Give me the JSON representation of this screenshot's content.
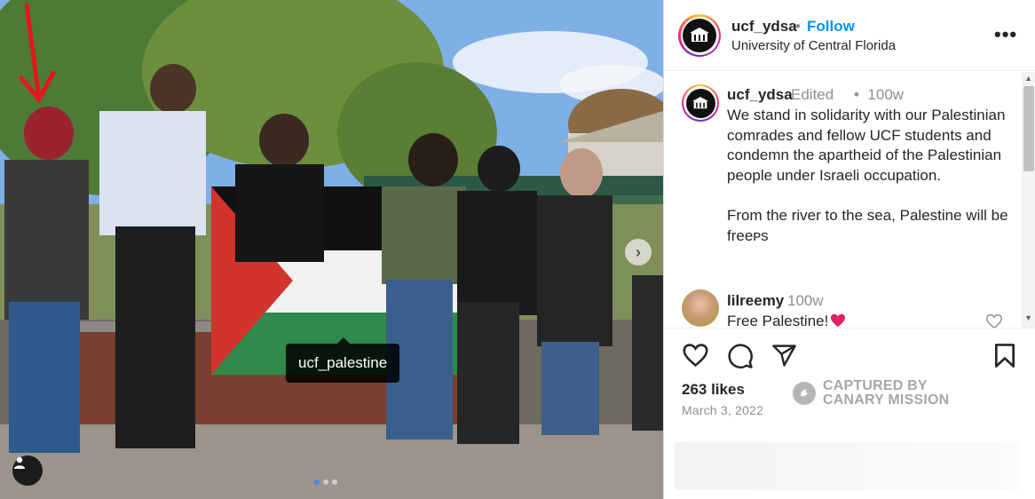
{
  "post_image": {
    "tag_label": "ucf_palestine",
    "carousel": {
      "count": 3,
      "active": 1
    }
  },
  "header": {
    "username": "ucf_ydsa",
    "separator": "•",
    "follow_label": "Follow",
    "location": "University of Central Florida",
    "more_icon": "more-horizontal-icon"
  },
  "caption": {
    "username": "ucf_ydsa",
    "edited": "Edited",
    "separator": "•",
    "time": "100w",
    "text": "We stand in solidarity with our Palestinian comrades and fellow UCF students and condemn the apartheid of the Palestinian people under Israeli occupation.\n\nFrom the river to the sea, Palestine will be freeᴘs"
  },
  "comments": [
    {
      "username": "lilreemy",
      "time": "100w",
      "text": "Free Palestine!",
      "emoji_icon": "red-heart-emoji-icon"
    }
  ],
  "actions": {
    "icons": [
      "heart-icon",
      "comment-icon",
      "share-icon",
      "bookmark-icon"
    ]
  },
  "stats": {
    "likes": "263 likes",
    "date": "March 3, 2022"
  },
  "watermark": {
    "line1": "CAPTURED BY",
    "line2": "CANARY MISSION"
  },
  "colors": {
    "follow": "#0095f6",
    "muted": "#8e8e8e",
    "text": "#262626",
    "annotation_arrow": "#e5161b",
    "heart_emoji": "#e0245e"
  }
}
